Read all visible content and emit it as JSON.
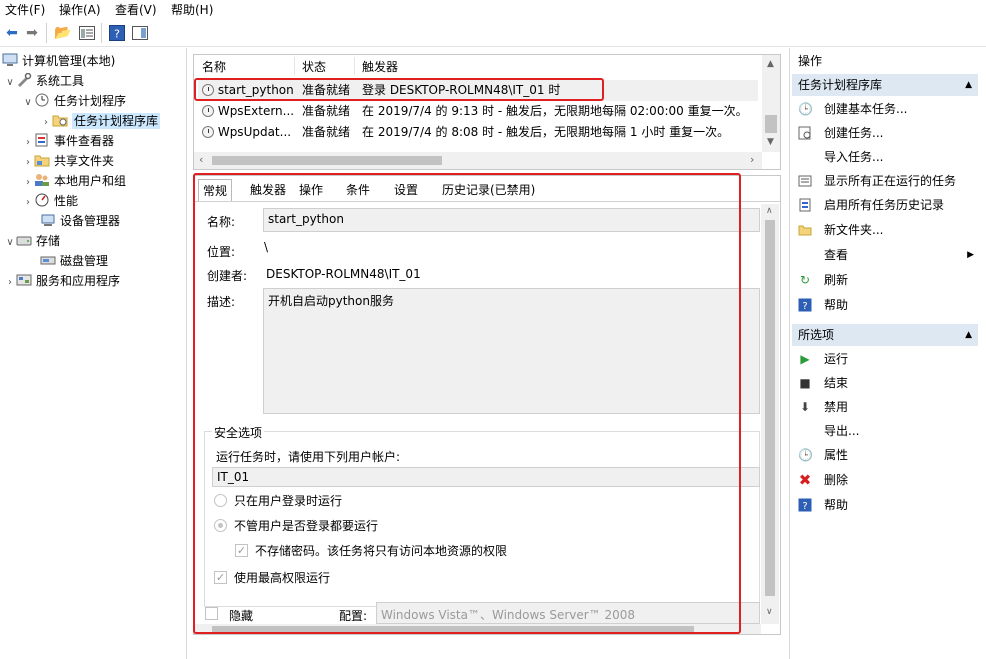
{
  "menu": {
    "file": "文件(F)",
    "action": "操作(A)",
    "view": "查看(V)",
    "help": "帮助(H)"
  },
  "tree": {
    "root": "计算机管理(本地)",
    "system_tools": "系统工具",
    "task_scheduler": "任务计划程序",
    "task_library": "任务计划程序库",
    "event_viewer": "事件查看器",
    "shared_folders": "共享文件夹",
    "local_users": "本地用户和组",
    "performance": "性能",
    "device_manager": "设备管理器",
    "storage": "存储",
    "disk_management": "磁盘管理",
    "services_apps": "服务和应用程序"
  },
  "tasklist": {
    "columns": {
      "name": "名称",
      "status": "状态",
      "trigger": "触发器"
    },
    "rows": [
      {
        "name": "start_python",
        "status": "准备就绪",
        "trigger": "登录 DESKTOP-ROLMN48\\IT_01 时"
      },
      {
        "name": "WpsExtern...",
        "status": "准备就绪",
        "trigger": "在 2019/7/4 的 9:13 时 - 触发后，无限期地每隔 02:00:00 重复一次。"
      },
      {
        "name": "WpsUpdat...",
        "status": "准备就绪",
        "trigger": "在 2019/7/4 的 8:08 时 - 触发后，无限期地每隔 1 小时 重复一次。"
      }
    ]
  },
  "props": {
    "tabs": [
      "常规",
      "触发器",
      "操作",
      "条件",
      "设置",
      "历史记录(已禁用)"
    ],
    "name_label": "名称:",
    "name_value": "start_python",
    "location_label": "位置:",
    "location_value": "\\",
    "author_label": "创建者:",
    "author_value": "DESKTOP-ROLMN48\\IT_01",
    "desc_label": "描述:",
    "desc_value": "开机自启动python服务",
    "security_title": "安全选项",
    "run_as_text": "运行任务时，请使用下列用户帐户:",
    "account": "IT_01",
    "opt_logged_on": "只在用户登录时运行",
    "opt_whether": "不管用户是否登录都要运行",
    "opt_no_password": "不存储密码。该任务将只有访问本地资源的权限",
    "opt_highest": "使用最高权限运行",
    "hidden_label": "隐藏",
    "config_label": "配置:",
    "config_value": "Windows Vista™、Windows Server™ 2008"
  },
  "actions": {
    "title": "操作",
    "group1": "任务计划程序库",
    "items1": [
      "创建基本任务...",
      "创建任务...",
      "导入任务...",
      "显示所有正在运行的任务",
      "启用所有任务历史记录",
      "新文件夹...",
      "查看",
      "刷新",
      "帮助"
    ],
    "group2": "所选项",
    "items2": [
      "运行",
      "结束",
      "禁用",
      "导出...",
      "属性",
      "删除",
      "帮助"
    ]
  },
  "colors": {
    "highlight_border": "#e02020",
    "group_header_bg": "#dde8f3",
    "selection_bg": "#cce8ff"
  }
}
